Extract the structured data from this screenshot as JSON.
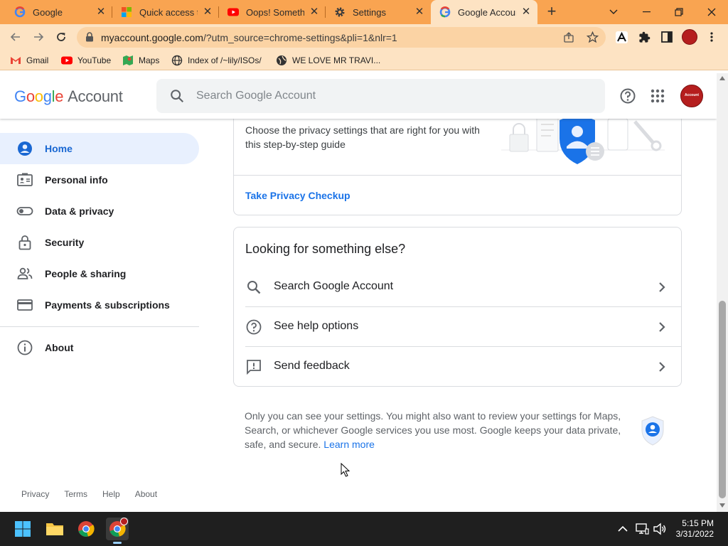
{
  "browser": {
    "tabs": [
      {
        "title": "Google",
        "favicon": "google-g-icon",
        "active": false
      },
      {
        "title": "Quick access to",
        "favicon": "microsoft-icon",
        "active": false
      },
      {
        "title": "Oops! Somethin",
        "favicon": "youtube-icon",
        "active": false
      },
      {
        "title": "Settings",
        "favicon": "gear-icon",
        "active": false
      },
      {
        "title": "Google Account",
        "favicon": "google-g-icon",
        "active": true
      }
    ],
    "url_domain": "myaccount.google.com",
    "url_path": "/?utm_source=chrome-settings&pli=1&nlr=1",
    "bookmarks": [
      {
        "label": "Gmail",
        "icon": "gmail-icon"
      },
      {
        "label": "YouTube",
        "icon": "youtube-icon"
      },
      {
        "label": "Maps",
        "icon": "maps-icon"
      },
      {
        "label": "Index of /~lily/ISOs/",
        "icon": "globe-icon"
      },
      {
        "label": "WE LOVE MR TRAVI...",
        "icon": "globe-icon"
      }
    ]
  },
  "header": {
    "logo_google": "Google",
    "logo_account": "Account",
    "search_placeholder": "Search Google Account",
    "avatar_text": "Account"
  },
  "sidebar": {
    "items": [
      {
        "label": "Home",
        "icon": "account-circle-icon",
        "active": true
      },
      {
        "label": "Personal info",
        "icon": "id-card-icon"
      },
      {
        "label": "Data & privacy",
        "icon": "toggle-icon"
      },
      {
        "label": "Security",
        "icon": "lock-icon"
      },
      {
        "label": "People & sharing",
        "icon": "people-icon"
      },
      {
        "label": "Payments & subscriptions",
        "icon": "credit-card-icon"
      }
    ],
    "about": {
      "label": "About",
      "icon": "info-icon"
    },
    "footer": [
      "Privacy",
      "Terms",
      "Help",
      "About"
    ]
  },
  "privacy_card": {
    "description": "Choose the privacy settings that are right for you with this step-by-step guide",
    "link": "Take Privacy Checkup"
  },
  "looking_card": {
    "title": "Looking for something else?",
    "rows": [
      {
        "label": "Search Google Account",
        "icon": "search-icon"
      },
      {
        "label": "See help options",
        "icon": "help-circle-icon"
      },
      {
        "label": "Send feedback",
        "icon": "feedback-icon"
      }
    ]
  },
  "note": {
    "text": "Only you can see your settings. You might also want to review your settings for Maps, Search, or whichever Google services you use most. Google keeps your data private, safe, and secure.",
    "link": "Learn more"
  },
  "taskbar": {
    "time": "5:15 PM",
    "date": "3/31/2022"
  },
  "colors": {
    "tab_bar": "#f9a451",
    "toolbar": "#fde3c3",
    "accent_blue": "#1a73e8",
    "active_nav_bg": "#e8f0fe"
  }
}
